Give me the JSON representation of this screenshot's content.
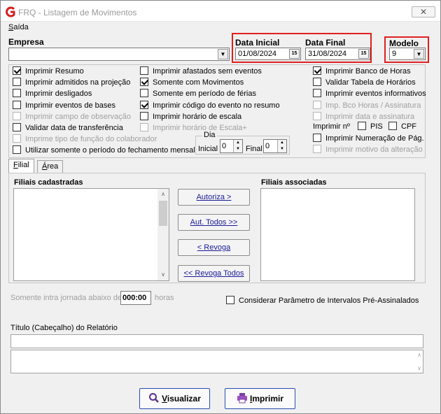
{
  "window": {
    "title": "FRQ - Listagem de Movimentos",
    "close_label": "✕"
  },
  "menu": {
    "saida_first": "S",
    "saida_rest": "aída"
  },
  "empresa": {
    "label": "Empresa",
    "value": ""
  },
  "data_inicial": {
    "label": "Data Inicial",
    "value": "01/08/2024"
  },
  "data_final": {
    "label": "Data Final",
    "value": "31/08/2024"
  },
  "calendar_icon_text": "15",
  "modelo": {
    "label": "Modelo",
    "value": "9"
  },
  "options_col1": [
    {
      "label": "Imprimir Resumo",
      "checked": true,
      "enabled": true
    },
    {
      "label": "Imprimir admitidos na projeção",
      "checked": false,
      "enabled": true
    },
    {
      "label": "Imprimir desligados",
      "checked": false,
      "enabled": true
    },
    {
      "label": "Imprimir eventos de bases",
      "checked": false,
      "enabled": true
    },
    {
      "label": "Imprimir campo de observação",
      "checked": false,
      "enabled": false
    },
    {
      "label": "Validar data de transferência",
      "checked": false,
      "enabled": true
    },
    {
      "label": "Imprime tipo de função do colaborador",
      "checked": false,
      "enabled": false
    },
    {
      "label": "Utilizar somente o período do fechamento mensal",
      "checked": false,
      "enabled": true
    }
  ],
  "options_col2": [
    {
      "label": "Imprimir afastados sem eventos",
      "checked": false,
      "enabled": true
    },
    {
      "label": "Somente com Movimentos",
      "checked": true,
      "enabled": true
    },
    {
      "label": "Somente em período de férias",
      "checked": false,
      "enabled": true
    },
    {
      "label": "Imprimir código do evento no resumo",
      "checked": true,
      "enabled": true
    },
    {
      "label": "Imprimir horário de escala",
      "checked": false,
      "enabled": true
    },
    {
      "label": "Imprimir horário de Escala+",
      "checked": false,
      "enabled": false
    }
  ],
  "options_col3": [
    {
      "label": "Imprimir Banco de Horas",
      "checked": true,
      "enabled": true
    },
    {
      "label": "Validar Tabela de Horários",
      "checked": false,
      "enabled": true
    },
    {
      "label": "Imprimir eventos informativos",
      "checked": false,
      "enabled": true
    },
    {
      "label": "Imp. Bco Horas / Assinatura",
      "checked": false,
      "enabled": false
    },
    {
      "label": "Imprimir data e assinatura",
      "checked": false,
      "enabled": false
    }
  ],
  "imprimir_n": {
    "label": "Imprimir nº",
    "pis": "PIS",
    "cpf": "CPF"
  },
  "options_col3b": [
    {
      "label": "Imprimir Numeração de Pág.",
      "checked": false,
      "enabled": true
    },
    {
      "label": "Imprimir motivo da alteração",
      "checked": false,
      "enabled": false
    }
  ],
  "dia": {
    "label": "Dia",
    "inicial_label": "Inicial",
    "inicial_value": "0",
    "final_label": "Final",
    "final_value": "0"
  },
  "tabs": [
    {
      "first": "F",
      "rest": "ilial",
      "active": true
    },
    {
      "first": "Á",
      "rest": "rea",
      "active": false
    }
  ],
  "filiais_cadastradas": {
    "label": "Filiais cadastradas"
  },
  "filiais_associadas": {
    "label": "Filiais associadas"
  },
  "buttons": {
    "autoriza": "Autoriza >",
    "aut_todos": "Aut. Todos >>",
    "revoga": "< Revoga",
    "revoga_todos": "<< Revoga Todos"
  },
  "intrajornada": {
    "label": "Somente intra jornada abaixo de",
    "value": "000:00",
    "unit": "horas"
  },
  "considerar": {
    "label": "Considerar Parâmetro de Intervalos Pré-Assinalados",
    "checked": false
  },
  "titulo": {
    "label": "Título (Cabeçalho) do Relatório",
    "value": ""
  },
  "actions": {
    "visualizar_first": "V",
    "visualizar_rest": "isualizar",
    "imprimir_first": "I",
    "imprimir_rest": "mprimir"
  }
}
